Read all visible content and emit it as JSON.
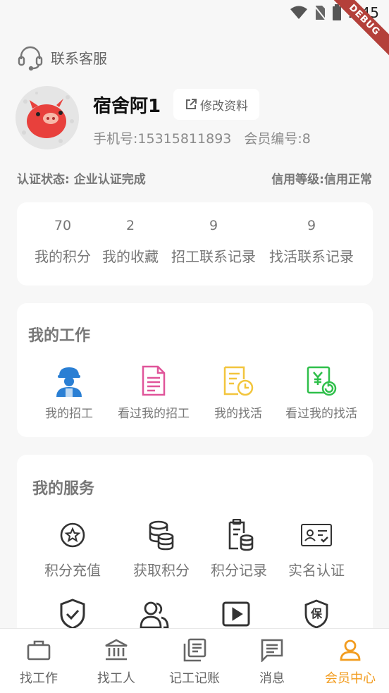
{
  "status_bar": {
    "time": "1:45",
    "debug_label": "DEBUG"
  },
  "service": {
    "label": "联系客服"
  },
  "profile": {
    "name": "宿舍阿1",
    "edit_label": "修改资料",
    "phone": "手机号:15315811893",
    "member_no": "会员编号:8"
  },
  "status": {
    "auth": "认证状态: 企业认证完成",
    "credit": "信用等级:信用正常"
  },
  "stats": [
    {
      "value": "70",
      "label": "我的积分"
    },
    {
      "value": "2",
      "label": "我的收藏"
    },
    {
      "value": "9",
      "label": "招工联系记录"
    },
    {
      "value": "9",
      "label": "找活联系记录"
    }
  ],
  "work": {
    "title": "我的工作",
    "items": [
      {
        "label": "我的招工",
        "icon": "worker-icon"
      },
      {
        "label": "看过我的招工",
        "icon": "document-icon"
      },
      {
        "label": "我的找活",
        "icon": "schedule-doc-icon"
      },
      {
        "label": "看过我的找活",
        "icon": "money-refresh-icon"
      }
    ]
  },
  "services": {
    "title": "我的服务",
    "items": [
      {
        "label": "积分充值",
        "icon": "star-coin-icon"
      },
      {
        "label": "获取积分",
        "icon": "coin-stack-icon"
      },
      {
        "label": "积分记录",
        "icon": "clipboard-coins-icon"
      },
      {
        "label": "实名认证",
        "icon": "id-card-icon"
      }
    ],
    "row2_icons": [
      "shield-check-icon",
      "users-icon",
      "video-play-icon",
      "insurance-icon"
    ],
    "insurance_glyph": "保"
  },
  "tabs": [
    {
      "label": "找工作",
      "icon": "briefcase-icon",
      "active": false
    },
    {
      "label": "找工人",
      "icon": "bank-icon",
      "active": false
    },
    {
      "label": "记工记账",
      "icon": "notebook-icon",
      "active": false
    },
    {
      "label": "消息",
      "icon": "message-icon",
      "active": false
    },
    {
      "label": "会员中心",
      "icon": "person-icon",
      "active": true
    }
  ],
  "colors": {
    "accent": "#f29c1f",
    "ribbon": "#b4403a",
    "worker_blue": "#2a7fd4",
    "doc_pink": "#e0559a",
    "doc_yellow": "#f2c53d",
    "money_green": "#2fbf4a"
  }
}
